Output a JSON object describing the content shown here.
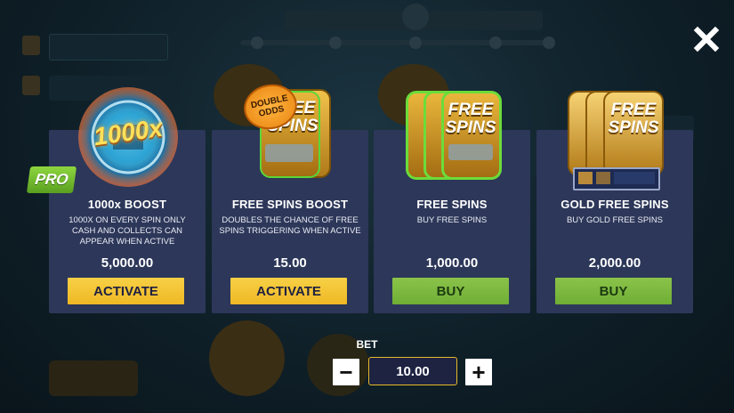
{
  "cards": [
    {
      "title": "1000x BOOST",
      "art_text": "1000x",
      "desc": "1000x ON EVERY SPIN ONLY CASH AND COLLECTS CAN APPEAR WHEN ACTIVE",
      "price": "5,000.00",
      "button": "ACTIVATE",
      "button_color": "#f3c431"
    },
    {
      "title": "FREE SPINS BOOST",
      "art_text": "FREE SPINS",
      "badge": "DOUBLE ODDS",
      "desc": "DOUBLES THE CHANCE OF FREE SPINS TRIGGERING WHEN ACTIVE",
      "price": "15.00",
      "button": "ACTIVATE",
      "button_color": "#f3c431"
    },
    {
      "title": "FREE SPINS",
      "art_text": "FREE SPINS",
      "desc": "BUY FREE SPINS",
      "price": "1,000.00",
      "button": "BUY",
      "button_color": "#7dba3f"
    },
    {
      "title": "GOLD FREE SPINS",
      "art_text": "FREE SPINS",
      "desc": "BUY GOLD FREE SPINS",
      "price": "2,000.00",
      "button": "BUY",
      "button_color": "#7dba3f"
    }
  ],
  "pro_badge": "PRO",
  "bet": {
    "label": "BET",
    "value": "10.00",
    "minus": "−",
    "plus": "+"
  },
  "icons": {
    "close": "close-icon",
    "minus": "minus-icon",
    "plus": "plus-icon"
  },
  "colors": {
    "card_bg": "#2d3759",
    "activate": "#f3c431",
    "buy": "#7dba3f",
    "bet_border": "#e8b92b"
  }
}
